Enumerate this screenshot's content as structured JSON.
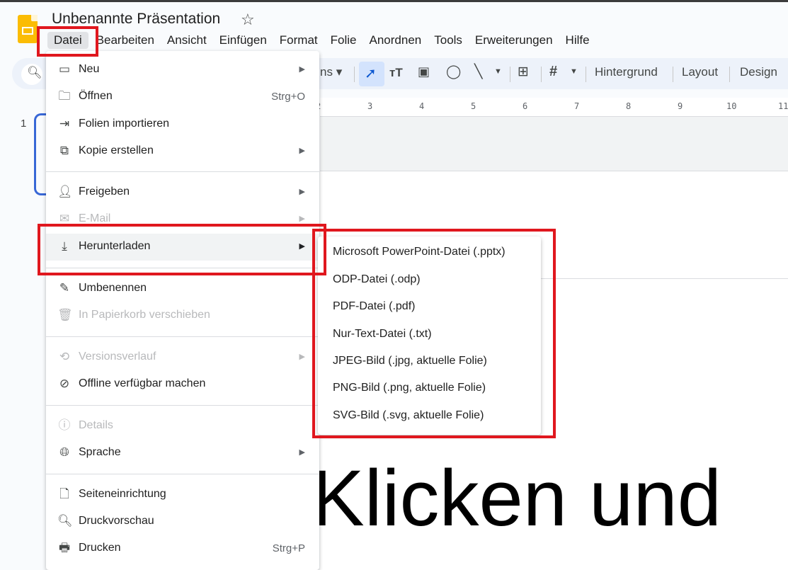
{
  "app": {
    "title": "Unbenannte Präsentation"
  },
  "menubar": [
    "Datei",
    "Bearbeiten",
    "Ansicht",
    "Einfügen",
    "Format",
    "Folie",
    "Anordnen",
    "Tools",
    "Erweiterungen",
    "Hilfe"
  ],
  "toolbar": {
    "partial_label": "ns",
    "background": "Hintergrund",
    "layout": "Layout",
    "design": "Design"
  },
  "ruler": [
    "2",
    "3",
    "4",
    "5",
    "6",
    "7",
    "8",
    "9",
    "10",
    "11"
  ],
  "slides_panel": {
    "slide_number": "1"
  },
  "slide": {
    "title_text": "Klicken und"
  },
  "file_menu": {
    "items": [
      {
        "label": "Neu",
        "icon": "slides-icon",
        "shortcut": "",
        "submenu": true,
        "disabled": false
      },
      {
        "label": "Öffnen",
        "icon": "folder-icon",
        "shortcut": "Strg+O",
        "submenu": false,
        "disabled": false
      },
      {
        "label": "Folien importieren",
        "icon": "import-icon",
        "shortcut": "",
        "submenu": false,
        "disabled": false
      },
      {
        "label": "Kopie erstellen",
        "icon": "copy-icon",
        "shortcut": "",
        "submenu": true,
        "disabled": false
      },
      {
        "label": "Freigeben",
        "icon": "person-add-icon",
        "shortcut": "",
        "submenu": true,
        "disabled": false
      },
      {
        "label": "E-Mail",
        "icon": "mail-icon",
        "shortcut": "",
        "submenu": true,
        "disabled": true
      },
      {
        "label": "Herunterladen",
        "icon": "download-icon",
        "shortcut": "",
        "submenu": true,
        "disabled": false
      },
      {
        "label": "Umbenennen",
        "icon": "rename-icon",
        "shortcut": "",
        "submenu": false,
        "disabled": false
      },
      {
        "label": "In Papierkorb verschieben",
        "icon": "trash-icon",
        "shortcut": "",
        "submenu": false,
        "disabled": true
      },
      {
        "label": "Versionsverlauf",
        "icon": "history-icon",
        "shortcut": "",
        "submenu": true,
        "disabled": true
      },
      {
        "label": "Offline verfügbar machen",
        "icon": "offline-icon",
        "shortcut": "",
        "submenu": false,
        "disabled": false
      },
      {
        "label": "Details",
        "icon": "info-icon",
        "shortcut": "",
        "submenu": false,
        "disabled": true
      },
      {
        "label": "Sprache",
        "icon": "globe-icon",
        "shortcut": "",
        "submenu": true,
        "disabled": false
      },
      {
        "label": "Seiteneinrichtung",
        "icon": "page-icon",
        "shortcut": "",
        "submenu": false,
        "disabled": false
      },
      {
        "label": "Druckvorschau",
        "icon": "print-preview-icon",
        "shortcut": "",
        "submenu": false,
        "disabled": false
      },
      {
        "label": "Drucken",
        "icon": "print-icon",
        "shortcut": "Strg+P",
        "submenu": false,
        "disabled": false
      }
    ]
  },
  "download_submenu": [
    "Microsoft PowerPoint-Datei (.pptx)",
    "ODP-Datei (.odp)",
    "PDF-Datei (.pdf)",
    "Nur-Text-Datei (.txt)",
    "JPEG-Bild (.jpg, aktuelle Folie)",
    "PNG-Bild (.png, aktuelle Folie)",
    "SVG-Bild (.svg, aktuelle Folie)"
  ],
  "colors": {
    "highlight_box": "#e0171e",
    "toolbar_bg": "#edf2fa",
    "logo": "#fbbc04",
    "active_tool": "#d3e3fd"
  }
}
